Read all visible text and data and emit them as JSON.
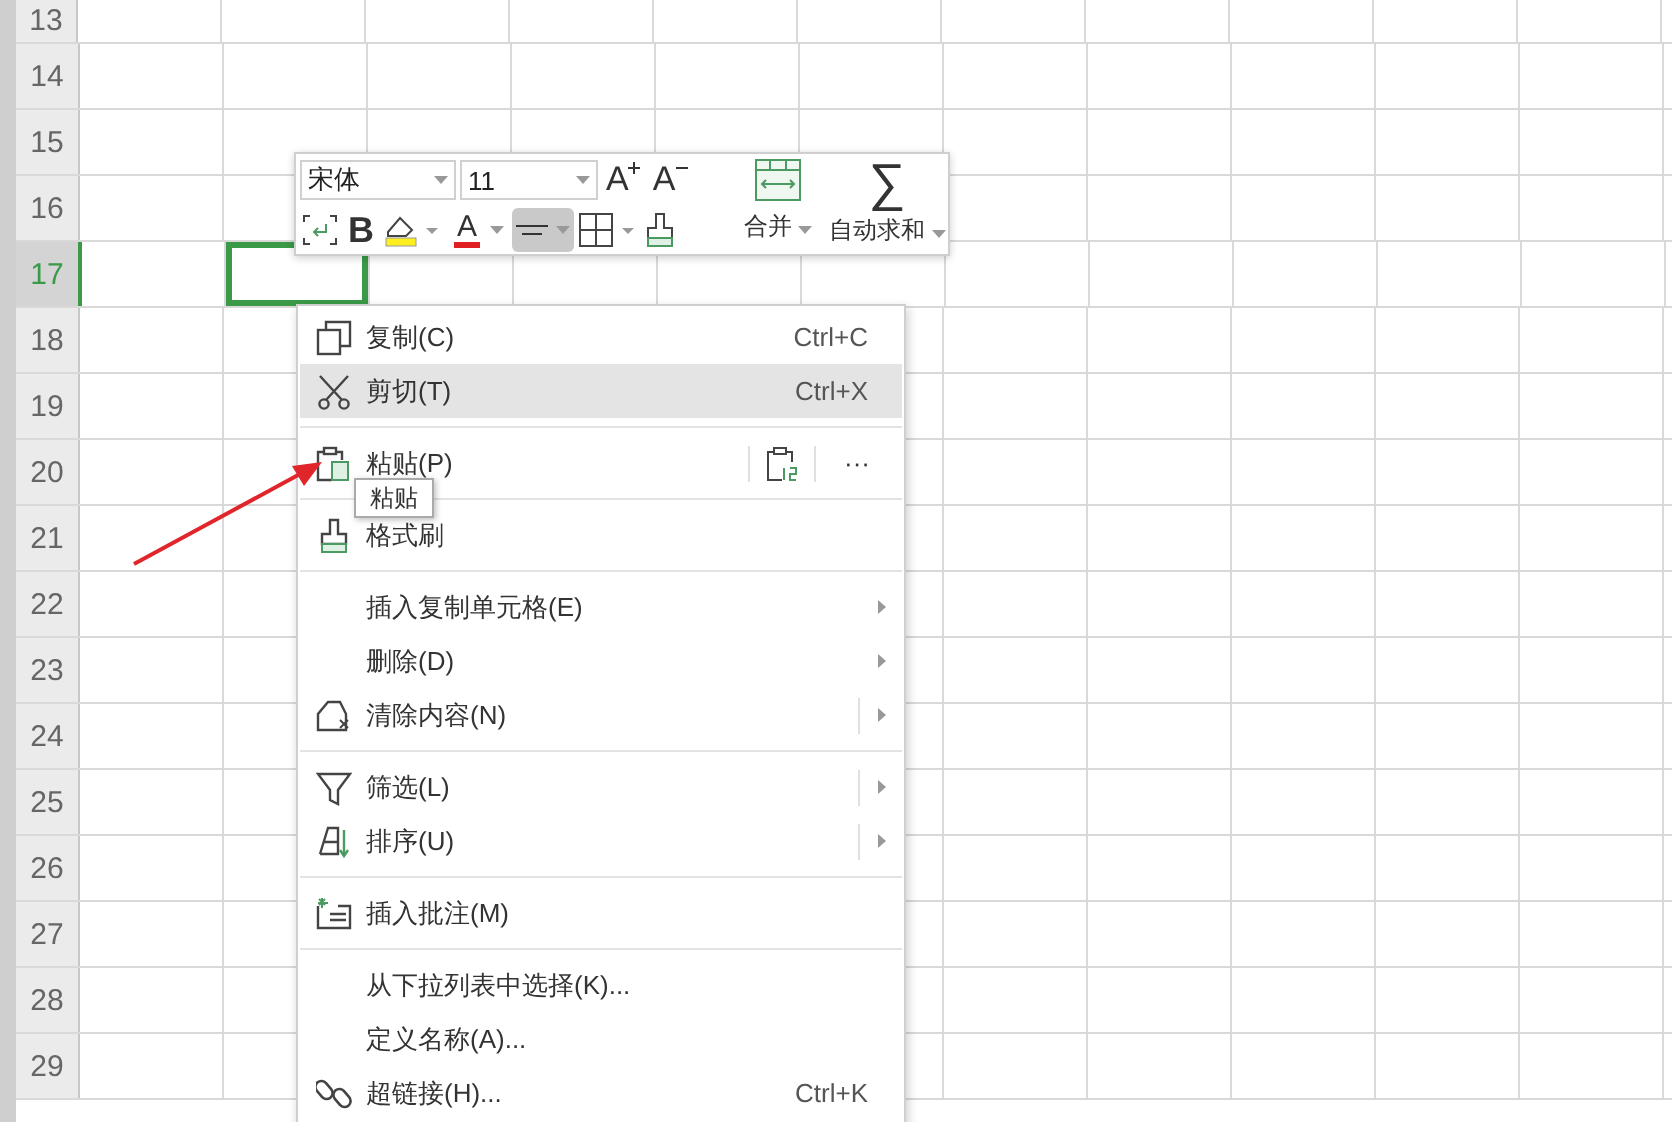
{
  "sheet": {
    "rows": [
      {
        "label": "13",
        "selected": false
      },
      {
        "label": "14",
        "selected": false
      },
      {
        "label": "15",
        "selected": false
      },
      {
        "label": "16",
        "selected": false
      },
      {
        "label": "17",
        "selected": true
      },
      {
        "label": "18",
        "selected": false
      },
      {
        "label": "19",
        "selected": false
      },
      {
        "label": "20",
        "selected": false
      },
      {
        "label": "21",
        "selected": false
      },
      {
        "label": "22",
        "selected": false
      },
      {
        "label": "23",
        "selected": false
      },
      {
        "label": "24",
        "selected": false
      },
      {
        "label": "25",
        "selected": false
      },
      {
        "label": "26",
        "selected": false
      },
      {
        "label": "27",
        "selected": false
      },
      {
        "label": "28",
        "selected": false
      },
      {
        "label": "29",
        "selected": false
      }
    ]
  },
  "mini_toolbar": {
    "font": {
      "value": "宋体"
    },
    "size": {
      "value": "11"
    },
    "grow_font": {
      "label": "A"
    },
    "shrink_font": {
      "label": "A"
    },
    "bold": {
      "label": "B"
    },
    "font_color": {
      "label": "A"
    },
    "align": {
      "selected": true
    },
    "merge": {
      "label": "合并"
    },
    "autosum": {
      "symbol": "∑",
      "label": "自动求和"
    }
  },
  "context_menu": {
    "items": [
      {
        "kind": "item",
        "label": "复制(C)",
        "shortcut": "Ctrl+C",
        "selected": false
      },
      {
        "kind": "item",
        "label": "剪切(T)",
        "shortcut": "Ctrl+X",
        "selected": true
      },
      {
        "kind": "separator"
      },
      {
        "kind": "paste",
        "label": "粘贴(P)",
        "more": "···",
        "selected": false
      },
      {
        "kind": "separator"
      },
      {
        "kind": "item",
        "label": "格式刷",
        "selected": false
      },
      {
        "kind": "separator"
      },
      {
        "kind": "item",
        "label": "插入复制单元格(E)",
        "submenu": true,
        "split": false,
        "selected": false
      },
      {
        "kind": "item",
        "label": "删除(D)",
        "submenu": true,
        "split": false,
        "selected": false
      },
      {
        "kind": "item",
        "label": "清除内容(N)",
        "submenu": true,
        "split": true,
        "selected": false
      },
      {
        "kind": "separator"
      },
      {
        "kind": "item",
        "label": "筛选(L)",
        "submenu": true,
        "split": true,
        "selected": false
      },
      {
        "kind": "item",
        "label": "排序(U)",
        "submenu": true,
        "split": true,
        "selected": false
      },
      {
        "kind": "separator"
      },
      {
        "kind": "item",
        "label": "插入批注(M)",
        "selected": false
      },
      {
        "kind": "separator"
      },
      {
        "kind": "item",
        "label": "从下拉列表中选择(K)...",
        "selected": false
      },
      {
        "kind": "item",
        "label": "定义名称(A)...",
        "selected": false
      },
      {
        "kind": "item",
        "label": "超链接(H)...",
        "shortcut": "Ctrl+K",
        "selected": false
      }
    ]
  },
  "tooltip": {
    "text": "粘贴"
  }
}
